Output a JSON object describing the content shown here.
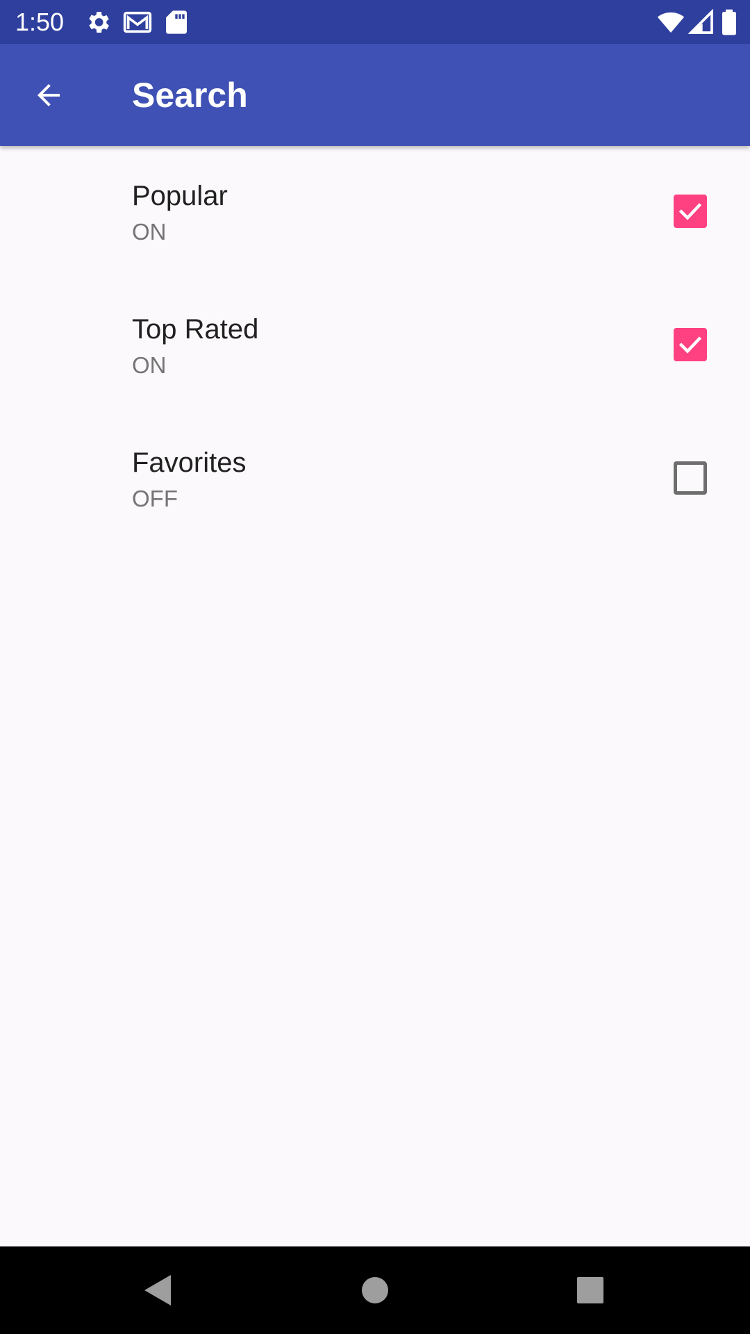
{
  "status_bar": {
    "time": "1:50",
    "icons": [
      "settings-icon",
      "gmail-icon",
      "sd-card-icon",
      "wifi-icon",
      "signal-icon",
      "battery-icon"
    ]
  },
  "app_bar": {
    "title": "Search",
    "back_icon": "arrow-back-icon",
    "color": "#3f51b5"
  },
  "preferences": [
    {
      "title": "Popular",
      "summary": "ON",
      "checked": true
    },
    {
      "title": "Top Rated",
      "summary": "ON",
      "checked": true
    },
    {
      "title": "Favorites",
      "summary": "OFF",
      "checked": false
    }
  ],
  "colors": {
    "status_bar": "#2f3f9e",
    "app_bar": "#3f51b5",
    "accent": "#ff4081",
    "background": "#fbf9fb"
  },
  "nav_bar": {
    "icons": [
      "back-triangle-icon",
      "home-circle-icon",
      "recents-square-icon"
    ]
  }
}
